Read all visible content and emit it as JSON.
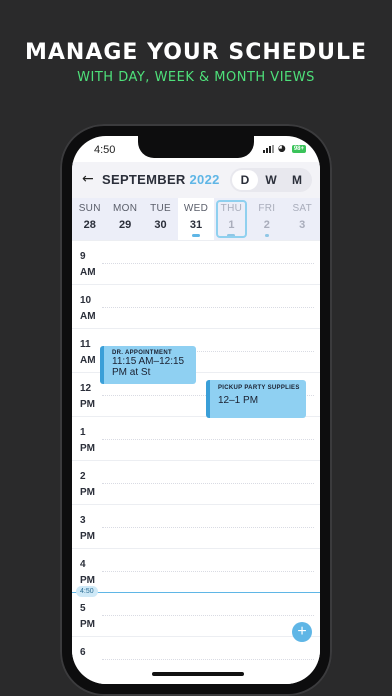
{
  "promo": {
    "headline": "MANAGE YOUR SCHEDULE",
    "subhead": "WITH DAY, WEEK & MONTH VIEWS"
  },
  "status_bar": {
    "time": "4:50",
    "battery": "98+"
  },
  "header": {
    "back_icon": "back-arrow-icon",
    "month": "SEPTEMBER",
    "year": "2022",
    "view_tabs": [
      "D",
      "W",
      "M"
    ],
    "active_view": "D"
  },
  "days": [
    {
      "name": "SUN",
      "num": "28"
    },
    {
      "name": "MON",
      "num": "29"
    },
    {
      "name": "TUE",
      "num": "30"
    },
    {
      "name": "WED",
      "num": "31"
    },
    {
      "name": "THU",
      "num": "1"
    },
    {
      "name": "FRI",
      "num": "2"
    },
    {
      "name": "SAT",
      "num": "3"
    }
  ],
  "hours": [
    {
      "num": "9",
      "period": "AM"
    },
    {
      "num": "10",
      "period": "AM"
    },
    {
      "num": "11",
      "period": "AM"
    },
    {
      "num": "12",
      "period": "PM"
    },
    {
      "num": "1",
      "period": "PM"
    },
    {
      "num": "2",
      "period": "PM"
    },
    {
      "num": "3",
      "period": "PM"
    },
    {
      "num": "4",
      "period": "PM"
    },
    {
      "num": "5",
      "period": "PM"
    },
    {
      "num": "6",
      "period": ""
    }
  ],
  "events": [
    {
      "title": "DR. APPOINTMENT",
      "time": "11:15 AM–12:15",
      "extra": "PM at St"
    },
    {
      "title": "PICKUP PARTY SUPPLIES",
      "time": "12–1 PM"
    }
  ],
  "now_indicator": "4:50",
  "add_button": "+",
  "colors": {
    "accent": "#5fb6e6",
    "promo_green": "#4ee07a",
    "event_fill": "#8fd0f2"
  }
}
